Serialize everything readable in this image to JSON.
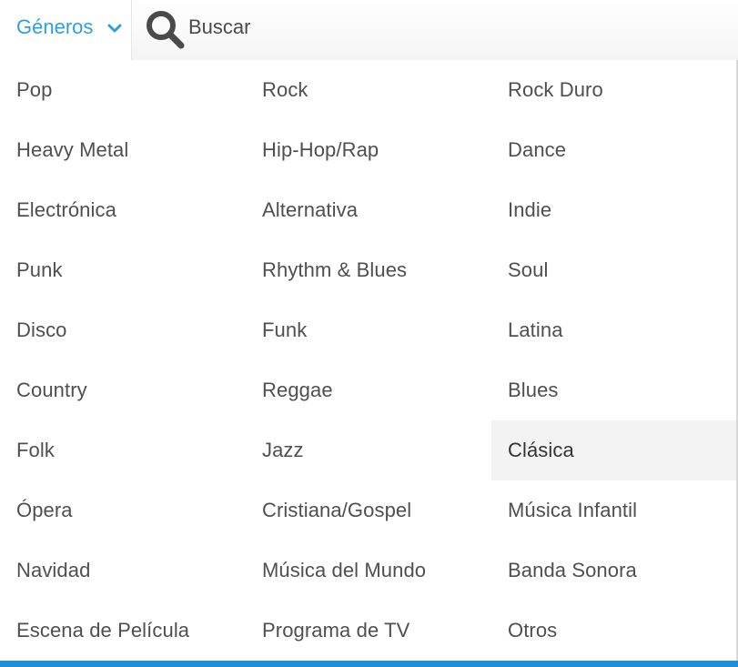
{
  "header": {
    "genres_label": "Géneros",
    "search_placeholder": "Buscar"
  },
  "icons": {
    "toggle": "chevron-down-icon",
    "search": "search-icon"
  },
  "colors": {
    "accent": "#2f9fdc",
    "bottom_bar": "#1f8fd6",
    "highlight_bg": "#f3f3f3"
  },
  "highlighted_item": "Clásica",
  "genres": [
    "Pop",
    "Rock",
    "Rock Duro",
    "Heavy Metal",
    "Hip-Hop/Rap",
    "Dance",
    "Electrónica",
    "Alternativa",
    "Indie",
    "Punk",
    "Rhythm & Blues",
    "Soul",
    "Disco",
    "Funk",
    "Latina",
    "Country",
    "Reggae",
    "Blues",
    "Folk",
    "Jazz",
    "Clásica",
    "Ópera",
    "Cristiana/Gospel",
    "Música Infantil",
    "Navidad",
    "Música del Mundo",
    "Banda Sonora",
    "Escena de Película",
    "Programa de TV",
    "Otros"
  ]
}
